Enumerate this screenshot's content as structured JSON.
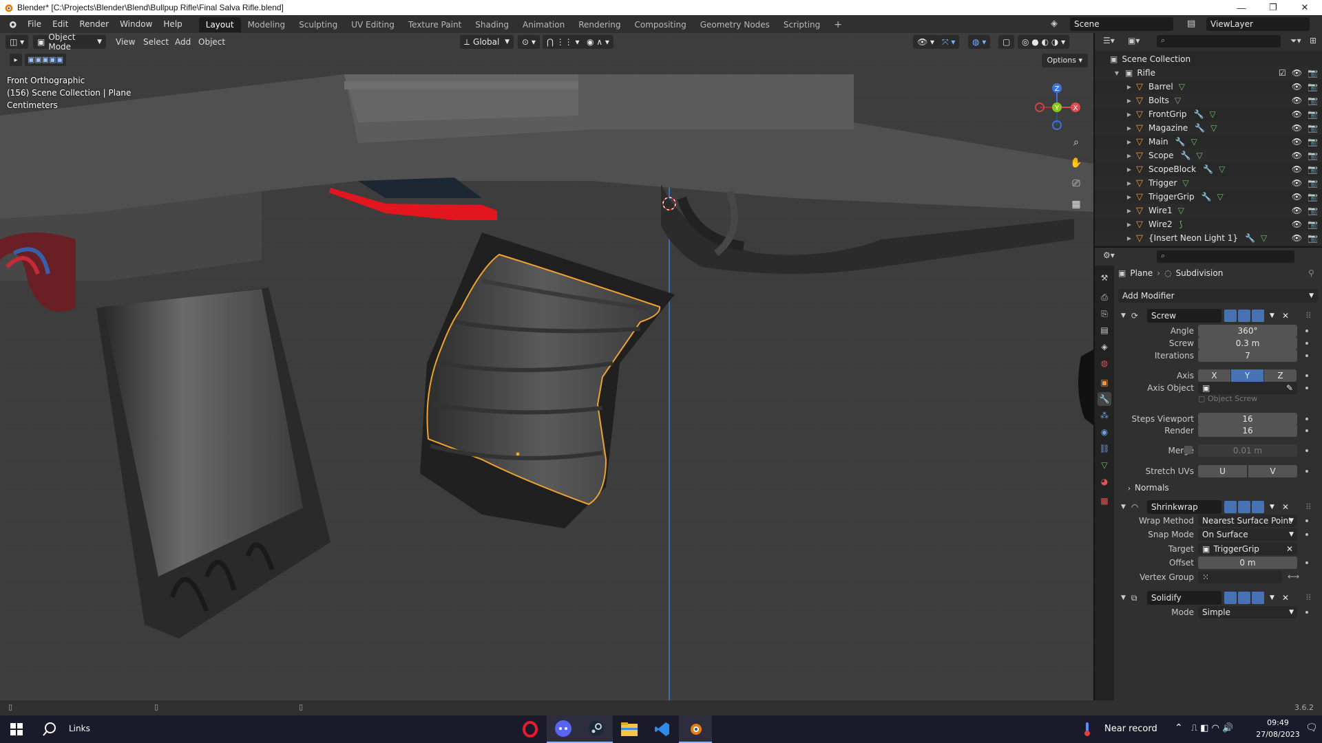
{
  "window": {
    "title": "Blender* [C:\\Projects\\Blender\\Blend\\Bullpup Rifle\\Final Salva Rifle.blend]",
    "minimize": "—",
    "maximize": "❐",
    "close": "✕"
  },
  "topbar": {
    "menus": [
      "File",
      "Edit",
      "Render",
      "Window",
      "Help"
    ],
    "workspaces": [
      "Layout",
      "Modeling",
      "Sculpting",
      "UV Editing",
      "Texture Paint",
      "Shading",
      "Animation",
      "Rendering",
      "Compositing",
      "Geometry Nodes",
      "Scripting"
    ],
    "active_workspace": "Layout",
    "add_workspace": "+",
    "scene": "Scene",
    "view_layer": "ViewLayer"
  },
  "viewport": {
    "mode": "Object Mode",
    "menus": [
      "View",
      "Select",
      "Add",
      "Object"
    ],
    "transform_orientation": "Global",
    "options": "Options",
    "view_name": "Front Orthographic",
    "collection_info": "(156) Scene Collection | Plane",
    "units": "Centimeters",
    "gizmo": {
      "z": "Z",
      "y": "Y",
      "x": "X"
    }
  },
  "outliner": {
    "root": "Scene Collection",
    "collection": "Rifle",
    "objects": [
      {
        "name": "Barrel",
        "modifier": false
      },
      {
        "name": "Bolts",
        "modifier": false
      },
      {
        "name": "FrontGrip",
        "modifier": true
      },
      {
        "name": "Magazine",
        "modifier": true
      },
      {
        "name": "Main",
        "modifier": true
      },
      {
        "name": "Scope",
        "modifier": true
      },
      {
        "name": "ScopeBlock",
        "modifier": true
      },
      {
        "name": "Trigger",
        "modifier": false
      },
      {
        "name": "TriggerGrip",
        "modifier": true
      },
      {
        "name": "Wire1",
        "modifier": false
      },
      {
        "name": "Wire2",
        "modifier": false,
        "curve": true
      },
      {
        "name": "{Insert Neon Light 1}",
        "modifier": true
      }
    ]
  },
  "properties": {
    "breadcrumb_object": "Plane",
    "breadcrumb_modifier": "Subdivision",
    "add_modifier": "Add Modifier",
    "screw": {
      "name": "Screw",
      "angle_label": "Angle",
      "angle": "360°",
      "screw_label": "Screw",
      "screw": "0.3 m",
      "iterations_label": "Iterations",
      "iterations": "7",
      "axis_label": "Axis",
      "axis_x": "X",
      "axis_y": "Y",
      "axis_z": "Z",
      "axis_object_label": "Axis Object",
      "object_screw": "Object Screw",
      "steps_viewport_label": "Steps Viewport",
      "steps_viewport": "16",
      "render_label": "Render",
      "render": "16",
      "merge_label": "Merge",
      "merge": "0.01 m",
      "stretch_uvs_label": "Stretch UVs",
      "u": "U",
      "v": "V",
      "normals": "Normals"
    },
    "shrinkwrap": {
      "name": "Shrinkwrap",
      "wrap_method_label": "Wrap Method",
      "wrap_method": "Nearest Surface Point",
      "snap_mode_label": "Snap Mode",
      "snap_mode": "On Surface",
      "target_label": "Target",
      "target": "TriggerGrip",
      "offset_label": "Offset",
      "offset": "0 m",
      "vertex_group_label": "Vertex Group"
    },
    "solidify": {
      "name": "Solidify",
      "mode_label": "Mode",
      "mode": "Simple"
    }
  },
  "statusbar": {
    "version": "3.6.2"
  },
  "taskbar": {
    "search": "Links",
    "weather": "Near record",
    "time": "09:49",
    "date": "27/08/2023"
  }
}
